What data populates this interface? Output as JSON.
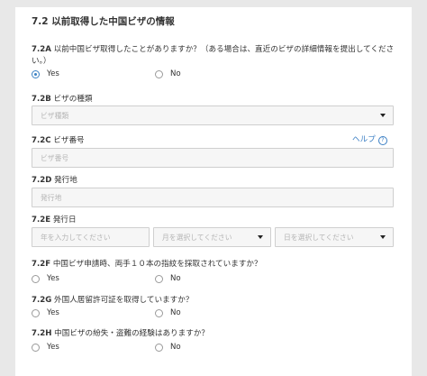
{
  "section_title": "7.2 以前取得した中国ビザの情報",
  "q7_2a": {
    "num": "7.2A",
    "text": " 以前中国ビザ取得したことがありますか？（ある場合は、直近のビザの詳細情報を提出してください。）",
    "line1": " 以前中国ビザ取得したことがありますか？（ある場合は、直近のビザの詳細情報を提出してくださ",
    "line2": "い。）",
    "yes": "Yes",
    "no": "No",
    "selected": "Yes"
  },
  "q7_2b": {
    "num": "7.2B",
    "label": " ビザの種類",
    "placeholder": "ビザ種類"
  },
  "q7_2c": {
    "num": "7.2C",
    "label": " ビザ番号",
    "placeholder": "ビザ番号",
    "help": "ヘルプ",
    "help_icon": "?"
  },
  "q7_2d": {
    "num": "7.2D",
    "label": " 発行地",
    "placeholder": "発行地"
  },
  "q7_2e": {
    "num": "7.2E",
    "label": " 発行日",
    "year_placeholder": "年を入力してください",
    "month_placeholder": "月を選択してください",
    "day_placeholder": "日を選択してください"
  },
  "q7_2f": {
    "num": "7.2F",
    "label": " 中国ビザ申請時、両手１０本の指紋を採取されていますか？",
    "yes": "Yes",
    "no": "No"
  },
  "q7_2g": {
    "num": "7.2G",
    "label": " 外国人居留許可証を取得していますか？",
    "yes": "Yes",
    "no": "No"
  },
  "q7_2h": {
    "num": "7.2H",
    "label": " 中国ビザの紛失・盗難の経験はありますか？",
    "yes": "Yes",
    "no": "No"
  },
  "colors": {
    "accent": "#3b82c4",
    "link": "#3b7fc4",
    "field_bg": "#f6f6f6",
    "page_bg": "#e8e8e8"
  }
}
